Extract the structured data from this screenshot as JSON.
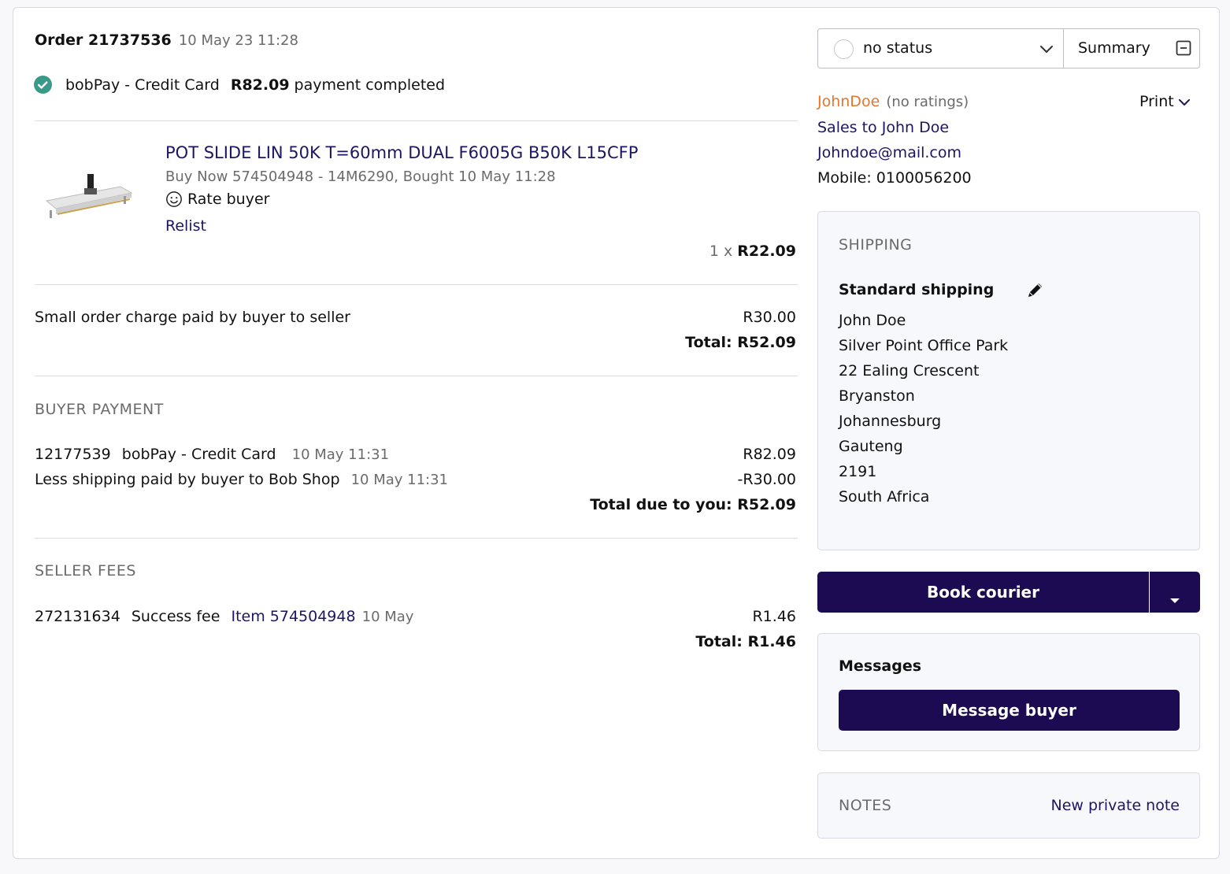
{
  "order": {
    "title": "Order 21737536",
    "datetime": "10 May 23 11:28",
    "payment_method": "bobPay - Credit Card",
    "payment_amount": "R82.09",
    "payment_status": "payment completed"
  },
  "item": {
    "title": "POT SLIDE LIN 50K T=60mm DUAL F6005G B50K L15CFP",
    "meta": "Buy Now 574504948 - 14M6290, Bought 10 May 11:28",
    "rate_label": "Rate buyer",
    "relist_label": "Relist",
    "qty": "1 x",
    "price": "R22.09"
  },
  "charges": {
    "label": "Small order charge paid by buyer to seller",
    "amount": "R30.00",
    "total": "Total: R52.09"
  },
  "buyer_payment": {
    "heading": "BUYER PAYMENT",
    "row1_id": "12177539",
    "row1_method": "bobPay - Credit Card",
    "row1_date": "10 May 11:31",
    "row1_amount": "R82.09",
    "row2_label": "Less shipping paid by buyer to Bob Shop",
    "row2_date": "10 May 11:31",
    "row2_amount": "-R30.00",
    "total": "Total due to you: R52.09"
  },
  "seller_fees": {
    "heading": "SELLER FEES",
    "id": "272131634",
    "label": "Success fee",
    "item_link": "Item 574504948",
    "date": "10 May",
    "amount": "R1.46",
    "total": "Total: R1.46"
  },
  "status": {
    "value": "no status",
    "summary_label": "Summary"
  },
  "buyer": {
    "username": "JohnDoe",
    "ratings": "(no ratings)",
    "print_label": "Print",
    "sales_link": "Sales to John Doe",
    "email": "Johndoe@mail.com",
    "mobile": "Mobile: 0100056200"
  },
  "shipping": {
    "heading": "SHIPPING",
    "method": "Standard shipping",
    "address": [
      "John Doe",
      "Silver Point Office Park",
      "22 Ealing Crescent",
      "Bryanston",
      "Johannesburg",
      "Gauteng",
      "2191",
      "South Africa"
    ]
  },
  "courier": {
    "label": "Book courier"
  },
  "messages": {
    "heading": "Messages",
    "button": "Message buyer"
  },
  "notes": {
    "heading": "NOTES",
    "new_note": "New private note"
  },
  "colors": {
    "primary": "#1c0a52",
    "link": "#1d1660",
    "username": "#e4762e",
    "success": "#3a9a8a"
  }
}
